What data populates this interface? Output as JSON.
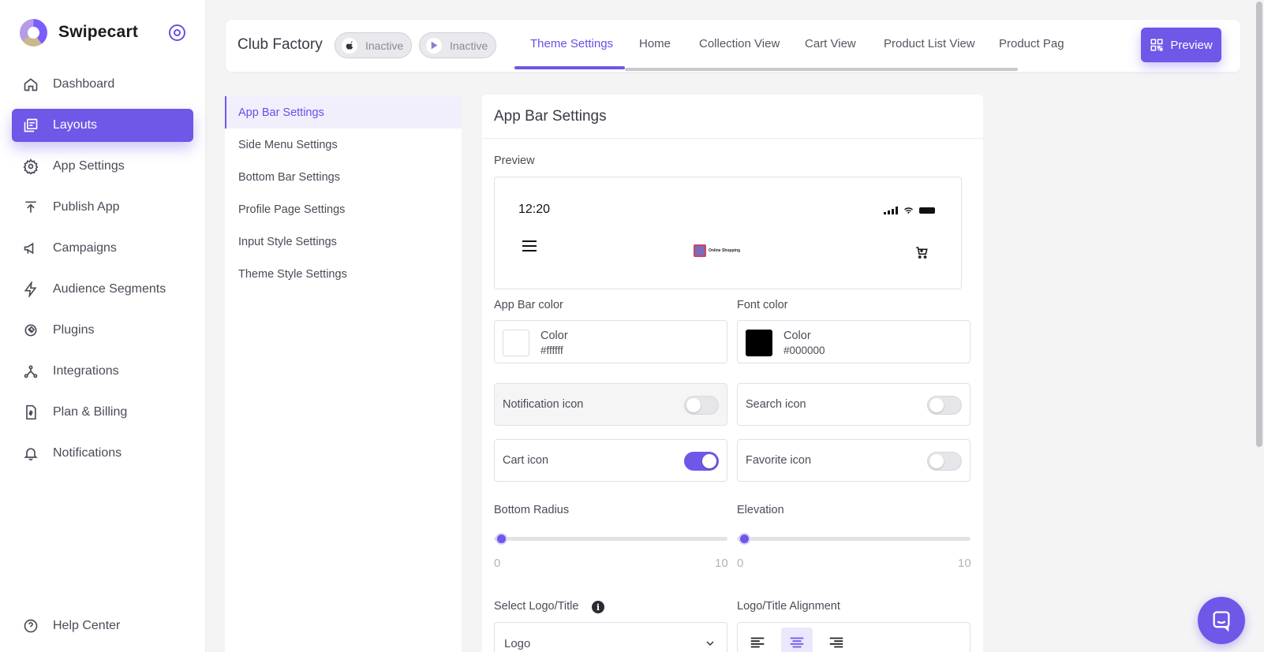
{
  "brand": {
    "name": "Swipecart"
  },
  "sidebar": {
    "items": [
      {
        "label": "Dashboard",
        "icon": "home-icon"
      },
      {
        "label": "Layouts",
        "icon": "layouts-icon",
        "active": true
      },
      {
        "label": "App Settings",
        "icon": "gear-icon"
      },
      {
        "label": "Publish App",
        "icon": "upload-icon"
      },
      {
        "label": "Campaigns",
        "icon": "megaphone-icon"
      },
      {
        "label": "Audience Segments",
        "icon": "lightning-icon"
      },
      {
        "label": "Plugins",
        "icon": "plug-icon"
      },
      {
        "label": "Integrations",
        "icon": "integrations-icon"
      },
      {
        "label": "Plan & Billing",
        "icon": "billing-icon"
      },
      {
        "label": "Notifications",
        "icon": "bell-icon"
      }
    ],
    "help": {
      "label": "Help Center",
      "icon": "help-icon"
    }
  },
  "topbar": {
    "store_name": "Club Factory",
    "ios_status": "Inactive",
    "android_status": "Inactive",
    "tabs": [
      "Theme Settings",
      "Home",
      "Collection View",
      "Cart View",
      "Product List View",
      "Product Pag"
    ],
    "active_tab": 0,
    "preview_label": "Preview"
  },
  "settings_list": {
    "items": [
      "App Bar Settings",
      "Side Menu Settings",
      "Bottom Bar Settings",
      "Profile Page Settings",
      "Input Style Settings",
      "Theme Style Settings"
    ],
    "active": 0
  },
  "panel": {
    "title": "App Bar Settings",
    "preview_label": "Preview",
    "phone": {
      "time": "12:20",
      "logo_text": "Online Shopping"
    },
    "app_bar_color": {
      "label": "App Bar color",
      "color_label": "Color",
      "value": "#ffffff"
    },
    "font_color": {
      "label": "Font color",
      "color_label": "Color",
      "value": "#000000"
    },
    "toggles": {
      "notification": {
        "label": "Notification icon",
        "on": false
      },
      "search": {
        "label": "Search icon",
        "on": false
      },
      "cart": {
        "label": "Cart icon",
        "on": true
      },
      "favorite": {
        "label": "Favorite icon",
        "on": false
      }
    },
    "bottom_radius": {
      "label": "Bottom Radius",
      "min": "0",
      "max": "10",
      "value": 0
    },
    "elevation": {
      "label": "Elevation",
      "min": "0",
      "max": "10",
      "value": 0
    },
    "logo_title": {
      "label": "Select Logo/Title",
      "value": "Logo"
    },
    "alignment": {
      "label": "Logo/Title Alignment",
      "selected": "center"
    }
  },
  "colors": {
    "accent": "#6f57e8"
  }
}
